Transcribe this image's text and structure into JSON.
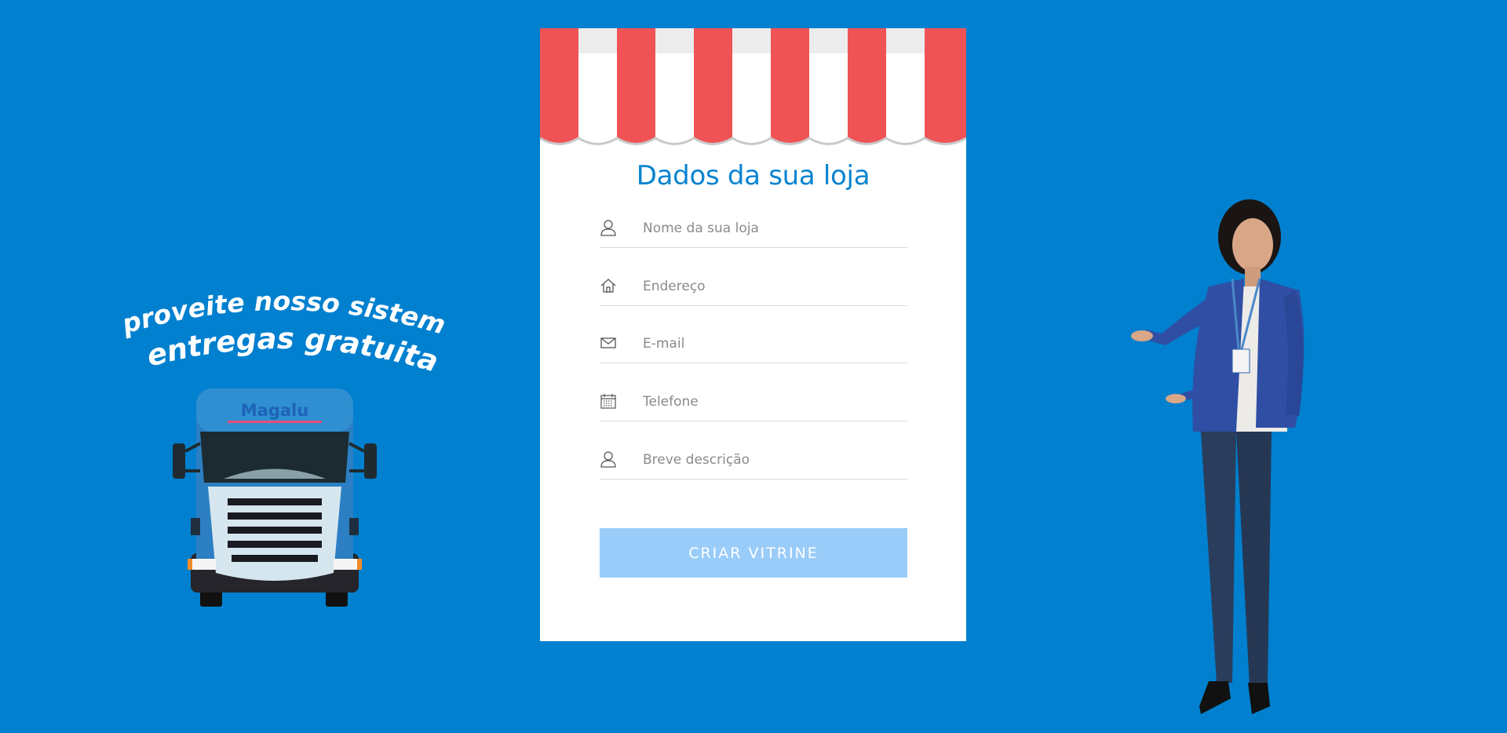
{
  "promo": {
    "line1": "Aproveite nosso sistema",
    "line2": "de entregas gratuitas!"
  },
  "truck": {
    "brand": "Magalu"
  },
  "form": {
    "title": "Dados da sua loja",
    "fields": [
      {
        "icon": "user-icon",
        "placeholder": "Nome da sua loja"
      },
      {
        "icon": "home-icon",
        "placeholder": "Endereço"
      },
      {
        "icon": "mail-icon",
        "placeholder": "E-mail"
      },
      {
        "icon": "calendar-icon",
        "placeholder": "Telefone"
      },
      {
        "icon": "user-icon",
        "placeholder": "Breve descrição"
      }
    ],
    "submit_label": "CRIAR VITRINE"
  },
  "colors": {
    "background": "#0080cf",
    "title": "#0a84d0",
    "awning_red": "#ef5355",
    "button": "#99ccf9"
  }
}
